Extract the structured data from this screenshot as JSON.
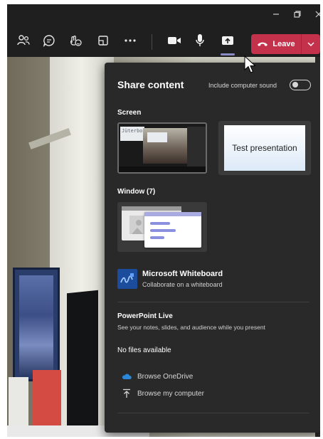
{
  "toolbar": {
    "icons": [
      "people-icon",
      "chat-icon",
      "react-icon",
      "rooms-icon",
      "more-icon",
      "camera-icon",
      "mic-icon",
      "share-icon"
    ],
    "leave_label": "Leave"
  },
  "share_panel": {
    "title": "Share content",
    "sound_label": "Include computer sound",
    "sound_enabled": false,
    "screen_section": "Screen",
    "screen_thumb_text": "Jüterbog",
    "presentation_thumb_text": "Test presentation",
    "window_section": "Window (7)",
    "whiteboard": {
      "title": "Microsoft Whiteboard",
      "subtitle": "Collaborate on a whiteboard"
    },
    "powerpoint": {
      "title": "PowerPoint Live",
      "subtitle": "See your notes, slides, and audience while you present",
      "empty": "No files available"
    },
    "links": {
      "onedrive": "Browse OneDrive",
      "computer": "Browse my computer"
    }
  },
  "colors": {
    "leave": "#c4314b",
    "panel_bg": "#292929",
    "accent": "#8b8cc7"
  }
}
